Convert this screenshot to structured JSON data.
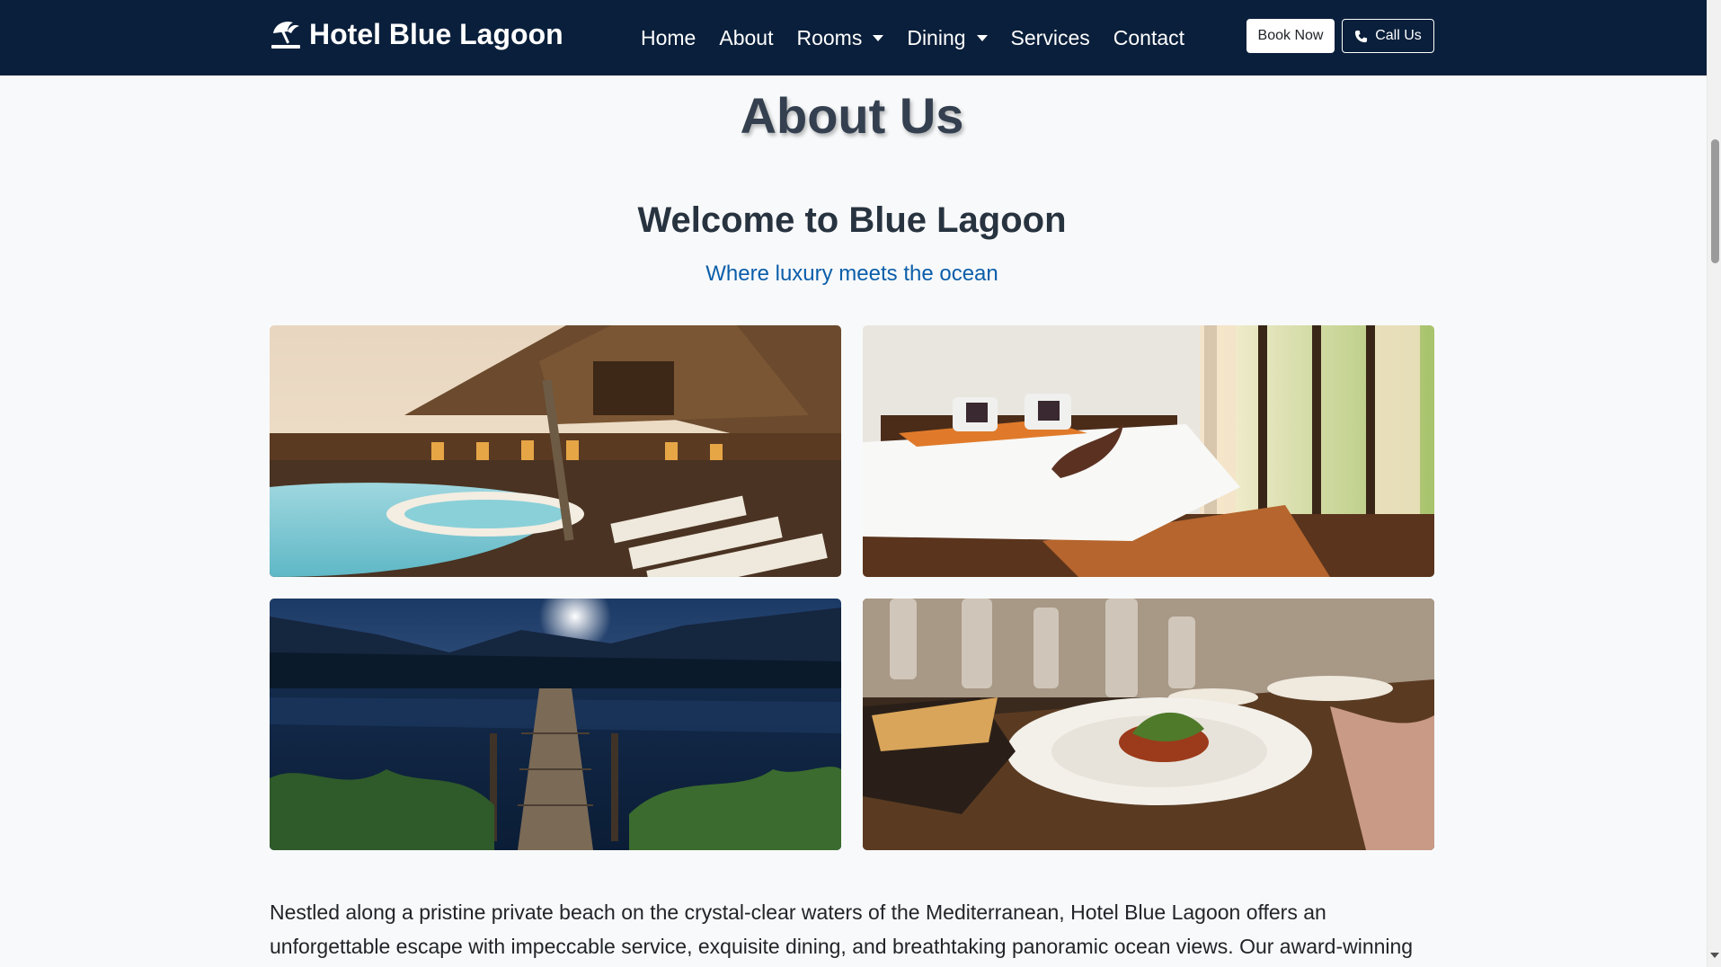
{
  "navbar": {
    "brand": "Hotel Blue Lagoon",
    "brand_icon": "umbrella-beach-icon",
    "links": [
      {
        "label": "Home"
      },
      {
        "label": "About"
      },
      {
        "label": "Rooms"
      },
      {
        "label": "Dining"
      },
      {
        "label": "Services"
      },
      {
        "label": "Contact"
      }
    ],
    "book_label": "Book Now",
    "call_label": "Call Us",
    "call_icon": "phone-icon"
  },
  "main": {
    "page_title": "About Us",
    "welcome": "Welcome to Blue Lagoon",
    "tagline": "Where luxury meets the ocean",
    "gallery": [
      {
        "subject": "resort-pool-photo"
      },
      {
        "subject": "bedroom-photo"
      },
      {
        "subject": "lake-dock-night-photo"
      },
      {
        "subject": "fine-dining-photo"
      }
    ],
    "intro": "Nestled along a pristine private beach on the crystal-clear waters of the Mediterranean, Hotel Blue Lagoon offers an unforgettable escape with impeccable service, exquisite dining, and breathtaking panoramic ocean views. Our award-winning resort blends"
  },
  "colors": {
    "navbar_bg": "#0a1f3b",
    "page_bg": "#f8f9fa",
    "tagline": "#0b5eaa",
    "heading": "#34404f"
  }
}
